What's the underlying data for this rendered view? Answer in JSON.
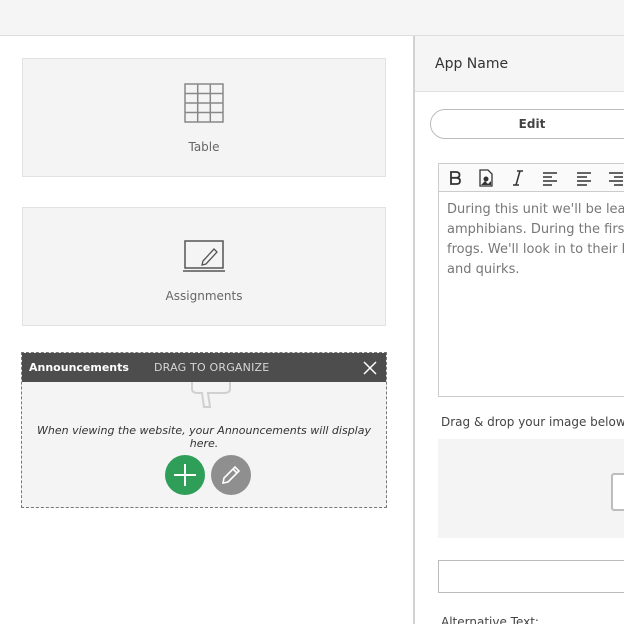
{
  "tiles": [
    {
      "label": "Table",
      "icon": "grid-table-icon"
    },
    {
      "label": "Assignments",
      "icon": "assignment-pencil-icon"
    }
  ],
  "announcements": {
    "title": "Announcements",
    "drag_hint": "DRAG TO ORGANIZE",
    "message": "When viewing the website, your Announcements will display here.",
    "add_icon": "plus-icon",
    "edit_icon": "pencil-icon",
    "close_icon": "close-icon",
    "colors": {
      "header": "#4d4d4d",
      "add": "#2e9e58",
      "edit": "#8f8f8f"
    }
  },
  "panel": {
    "app_name": "App Name",
    "edit_label": "Edit",
    "toolbar_icons": [
      "bold-icon",
      "insert-image-icon",
      "italic-icon",
      "align-left-icon",
      "align-center-icon",
      "align-right-icon"
    ],
    "editor_text": "During this unit we'll be lear\namphibians. During the firs\nfrogs. We'll look in to their b\nand quirks.",
    "dnd_label": "Drag & drop your image below or",
    "alt_label": "Alternative Text:"
  }
}
